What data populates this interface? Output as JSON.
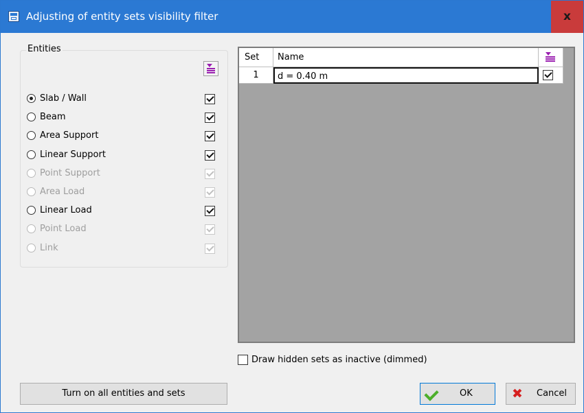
{
  "window": {
    "title": "Adjusting of entity sets visibility filter",
    "close_label": "x",
    "icons": {
      "app": "app-window-icon",
      "close": "close-icon"
    },
    "colors": {
      "titlebar": "#2b79d3",
      "close": "#c93b3b",
      "accent": "#9a1fb0"
    }
  },
  "entities": {
    "group_label": "Entities",
    "sort_icon": "sort-toggle-icon",
    "items": [
      {
        "label": "Slab / Wall",
        "selected": true,
        "enabled": true,
        "checked": true
      },
      {
        "label": "Beam",
        "selected": false,
        "enabled": true,
        "checked": true
      },
      {
        "label": "Area Support",
        "selected": false,
        "enabled": true,
        "checked": true
      },
      {
        "label": "Linear Support",
        "selected": false,
        "enabled": true,
        "checked": true
      },
      {
        "label": "Point Support",
        "selected": false,
        "enabled": false,
        "checked": true
      },
      {
        "label": "Area Load",
        "selected": false,
        "enabled": false,
        "checked": true
      },
      {
        "label": "Linear Load",
        "selected": false,
        "enabled": true,
        "checked": true
      },
      {
        "label": "Point Load",
        "selected": false,
        "enabled": false,
        "checked": true
      },
      {
        "label": "Link",
        "selected": false,
        "enabled": false,
        "checked": true
      }
    ]
  },
  "sets_table": {
    "columns": [
      "Set",
      "Name"
    ],
    "sort_icon": "sort-toggle-icon",
    "rows": [
      {
        "set": "1",
        "name": "d = 0.40 m",
        "visible": true
      }
    ]
  },
  "options": {
    "draw_hidden_label": "Draw hidden sets as inactive (dimmed)",
    "draw_hidden_checked": false
  },
  "buttons": {
    "turn_on_all": "Turn on all entities and sets",
    "ok": "OK",
    "cancel": "Cancel",
    "ok_icon": "checkmark-icon",
    "cancel_icon": "cross-icon"
  }
}
